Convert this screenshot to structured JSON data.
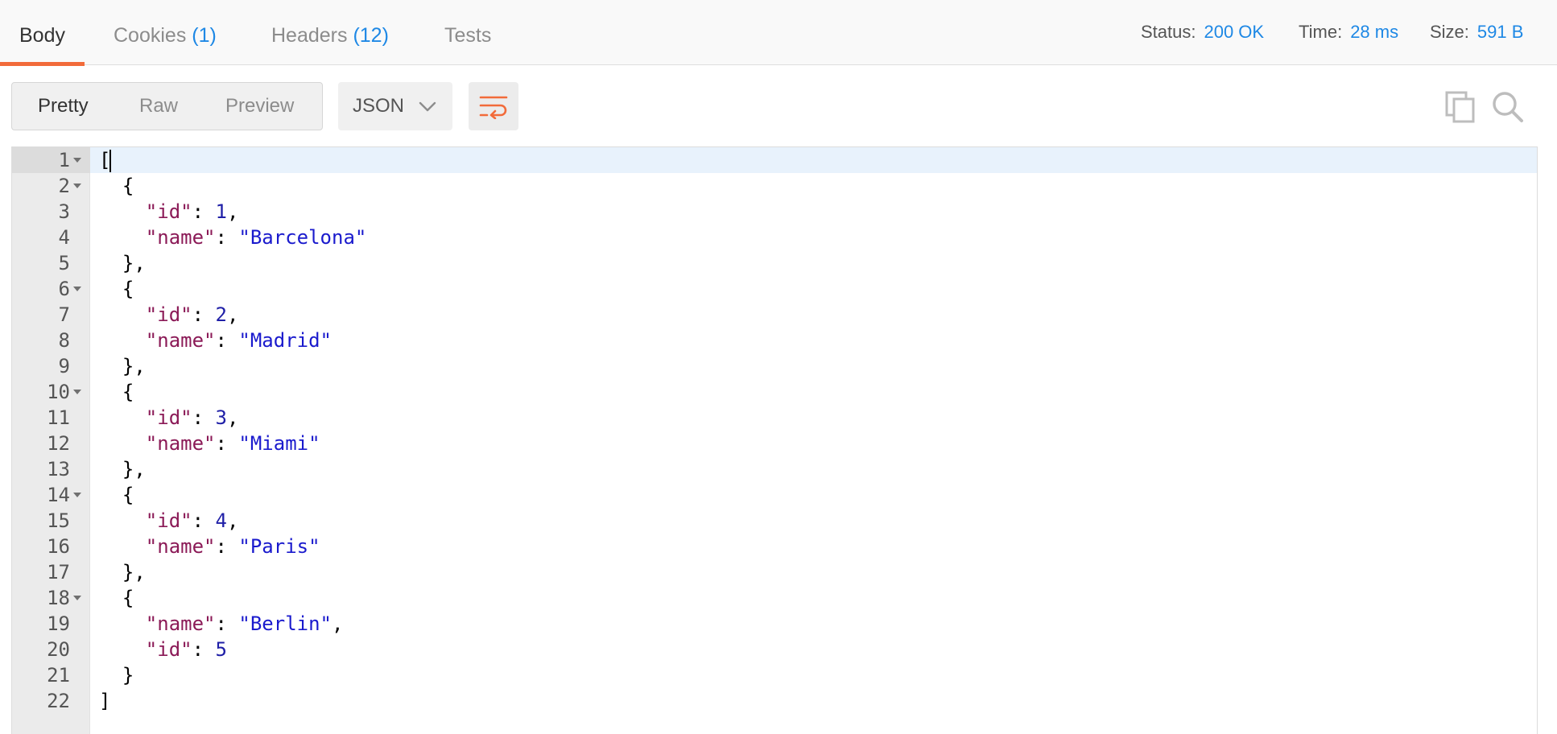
{
  "tabs": {
    "body": "Body",
    "cookies": "Cookies",
    "cookies_count": "(1)",
    "headers": "Headers",
    "headers_count": "(12)",
    "tests": "Tests"
  },
  "meta": {
    "status_label": "Status:",
    "status_value": "200 OK",
    "time_label": "Time:",
    "time_value": "28 ms",
    "size_label": "Size:",
    "size_value": "591 B"
  },
  "toolbar": {
    "views": [
      "Pretty",
      "Raw",
      "Preview"
    ],
    "active_view": "Pretty",
    "format": "JSON",
    "icons": {
      "wrap": "wrap-lines-icon",
      "copy": "copy-icon",
      "search": "search-icon"
    }
  },
  "colors": {
    "accent": "#f26b3a",
    "link": "#1e88e5",
    "json_key": "#8b1a57",
    "json_number": "#1f1fa7",
    "json_string": "#1a1acd"
  },
  "editor": {
    "active_line": 1,
    "lines": [
      {
        "n": "1",
        "fold": true,
        "tokens": [
          [
            "pun",
            "["
          ]
        ]
      },
      {
        "n": "2",
        "fold": true,
        "tokens": [
          [
            "pun",
            "  {"
          ]
        ]
      },
      {
        "n": "3",
        "fold": false,
        "tokens": [
          [
            "pun",
            "    "
          ],
          [
            "key",
            "\"id\""
          ],
          [
            "pun",
            ": "
          ],
          [
            "num",
            "1"
          ],
          [
            "pun",
            ","
          ]
        ]
      },
      {
        "n": "4",
        "fold": false,
        "tokens": [
          [
            "pun",
            "    "
          ],
          [
            "key",
            "\"name\""
          ],
          [
            "pun",
            ": "
          ],
          [
            "str",
            "\"Barcelona\""
          ]
        ]
      },
      {
        "n": "5",
        "fold": false,
        "tokens": [
          [
            "pun",
            "  },"
          ]
        ]
      },
      {
        "n": "6",
        "fold": true,
        "tokens": [
          [
            "pun",
            "  {"
          ]
        ]
      },
      {
        "n": "7",
        "fold": false,
        "tokens": [
          [
            "pun",
            "    "
          ],
          [
            "key",
            "\"id\""
          ],
          [
            "pun",
            ": "
          ],
          [
            "num",
            "2"
          ],
          [
            "pun",
            ","
          ]
        ]
      },
      {
        "n": "8",
        "fold": false,
        "tokens": [
          [
            "pun",
            "    "
          ],
          [
            "key",
            "\"name\""
          ],
          [
            "pun",
            ": "
          ],
          [
            "str",
            "\"Madrid\""
          ]
        ]
      },
      {
        "n": "9",
        "fold": false,
        "tokens": [
          [
            "pun",
            "  },"
          ]
        ]
      },
      {
        "n": "10",
        "fold": true,
        "tokens": [
          [
            "pun",
            "  {"
          ]
        ]
      },
      {
        "n": "11",
        "fold": false,
        "tokens": [
          [
            "pun",
            "    "
          ],
          [
            "key",
            "\"id\""
          ],
          [
            "pun",
            ": "
          ],
          [
            "num",
            "3"
          ],
          [
            "pun",
            ","
          ]
        ]
      },
      {
        "n": "12",
        "fold": false,
        "tokens": [
          [
            "pun",
            "    "
          ],
          [
            "key",
            "\"name\""
          ],
          [
            "pun",
            ": "
          ],
          [
            "str",
            "\"Miami\""
          ]
        ]
      },
      {
        "n": "13",
        "fold": false,
        "tokens": [
          [
            "pun",
            "  },"
          ]
        ]
      },
      {
        "n": "14",
        "fold": true,
        "tokens": [
          [
            "pun",
            "  {"
          ]
        ]
      },
      {
        "n": "15",
        "fold": false,
        "tokens": [
          [
            "pun",
            "    "
          ],
          [
            "key",
            "\"id\""
          ],
          [
            "pun",
            ": "
          ],
          [
            "num",
            "4"
          ],
          [
            "pun",
            ","
          ]
        ]
      },
      {
        "n": "16",
        "fold": false,
        "tokens": [
          [
            "pun",
            "    "
          ],
          [
            "key",
            "\"name\""
          ],
          [
            "pun",
            ": "
          ],
          [
            "str",
            "\"Paris\""
          ]
        ]
      },
      {
        "n": "17",
        "fold": false,
        "tokens": [
          [
            "pun",
            "  },"
          ]
        ]
      },
      {
        "n": "18",
        "fold": true,
        "tokens": [
          [
            "pun",
            "  {"
          ]
        ]
      },
      {
        "n": "19",
        "fold": false,
        "tokens": [
          [
            "pun",
            "    "
          ],
          [
            "key",
            "\"name\""
          ],
          [
            "pun",
            ": "
          ],
          [
            "str",
            "\"Berlin\""
          ],
          [
            "pun",
            ","
          ]
        ]
      },
      {
        "n": "20",
        "fold": false,
        "tokens": [
          [
            "pun",
            "    "
          ],
          [
            "key",
            "\"id\""
          ],
          [
            "pun",
            ": "
          ],
          [
            "num",
            "5"
          ]
        ]
      },
      {
        "n": "21",
        "fold": false,
        "tokens": [
          [
            "pun",
            "  }"
          ]
        ]
      },
      {
        "n": "22",
        "fold": false,
        "tokens": [
          [
            "pun",
            "]"
          ]
        ]
      }
    ]
  }
}
